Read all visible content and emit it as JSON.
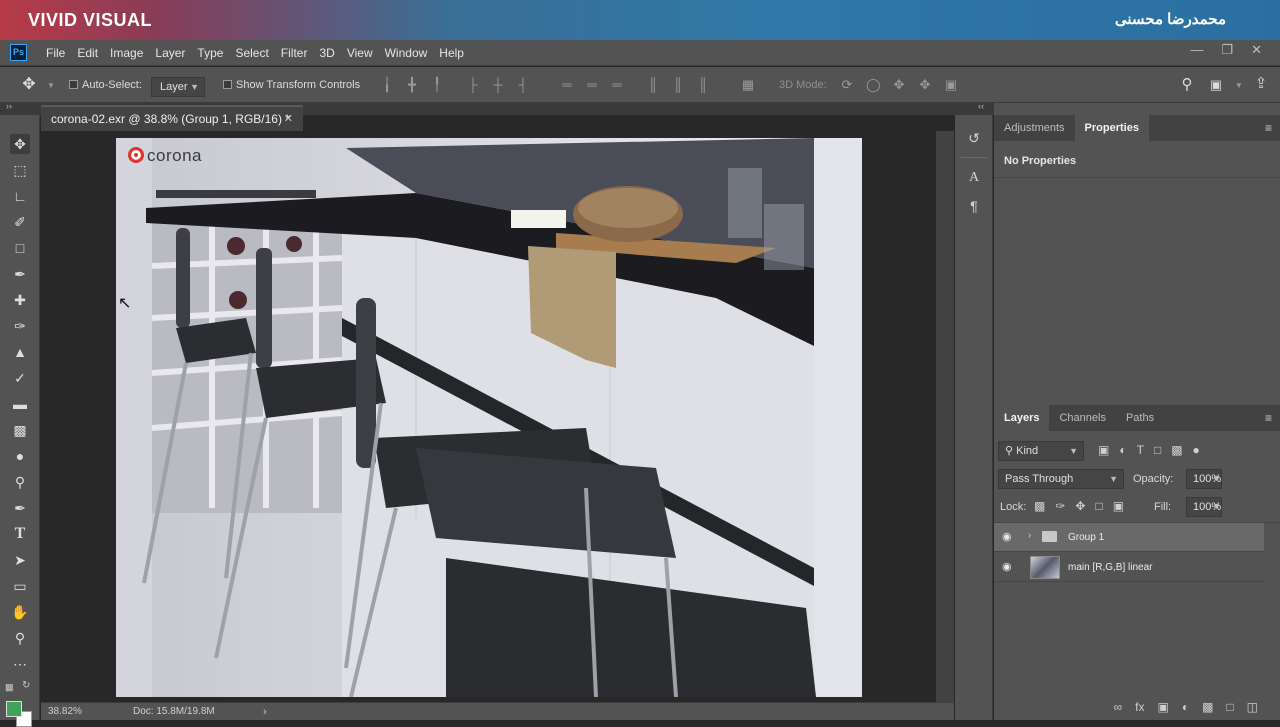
{
  "banner": {
    "brand": "VIVID VISUAL",
    "author": "محمدرضا محسنی"
  },
  "app": {
    "logo": "Ps"
  },
  "menu": [
    "File",
    "Edit",
    "Image",
    "Layer",
    "Type",
    "Select",
    "Filter",
    "3D",
    "View",
    "Window",
    "Help"
  ],
  "options": {
    "auto_select_label": "Auto-Select:",
    "auto_select_target": "Layer",
    "transform_controls_label": "Show Transform Controls",
    "mode_3d_label": "3D Mode:"
  },
  "document": {
    "tab_title": "corona-02.exr @ 38.8% (Group 1, RGB/16) *",
    "watermark": "corona"
  },
  "status": {
    "zoom": "38.82%",
    "doc_size": "Doc: 15.8M/19.8M"
  },
  "properties_panel": {
    "tabs": [
      "Adjustments",
      "Properties"
    ],
    "active_tab": "Properties",
    "message": "No Properties"
  },
  "layers_panel": {
    "tabs": [
      "Layers",
      "Channels",
      "Paths"
    ],
    "active_tab": "Layers",
    "filter_label": "Kind",
    "blend_mode": "Pass Through",
    "opacity_label": "Opacity:",
    "opacity": "100%",
    "lock_label": "Lock:",
    "fill_label": "Fill:",
    "fill": "100%",
    "layers": [
      {
        "name": "Group 1",
        "type": "group",
        "selected": true
      },
      {
        "name": "main [R,G,B] linear",
        "type": "pixel",
        "selected": false
      }
    ]
  },
  "colors": {
    "foreground": "#3fa35a",
    "background": "#ffffff",
    "accent": "#31a8ff"
  }
}
